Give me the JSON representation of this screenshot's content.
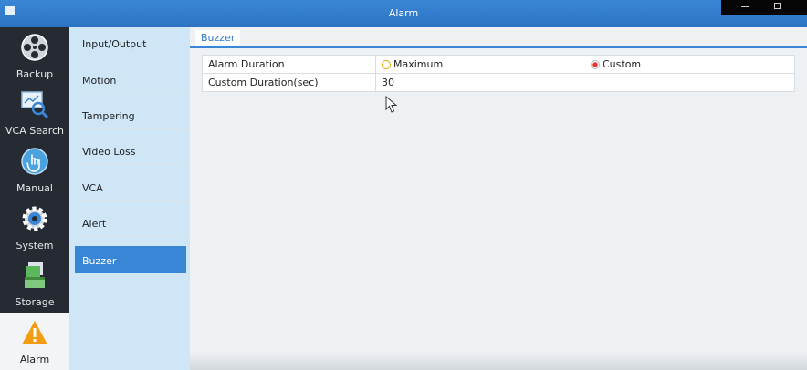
{
  "window": {
    "title": "Alarm",
    "controls": [
      "minimize-icon",
      "maximize-icon"
    ]
  },
  "left_nav": [
    {
      "label": "Backup",
      "icon": "backup-reel-icon"
    },
    {
      "label": "VCA Search",
      "icon": "vca-search-icon"
    },
    {
      "label": "Manual",
      "icon": "manual-hand-icon"
    },
    {
      "label": "System",
      "icon": "system-gear-icon"
    },
    {
      "label": "Storage",
      "icon": "storage-icon"
    },
    {
      "label": "Alarm",
      "icon": "alarm-warning-icon",
      "active": true
    }
  ],
  "sub_menu": [
    {
      "label": "Input/Output"
    },
    {
      "label": "Motion"
    },
    {
      "label": "Tampering"
    },
    {
      "label": "Video Loss"
    },
    {
      "label": "VCA"
    },
    {
      "label": "Alert"
    },
    {
      "label": "Buzzer",
      "active": true
    }
  ],
  "tab": {
    "label": "Buzzer"
  },
  "form": {
    "alarm_duration": {
      "label": "Alarm Duration",
      "options": [
        {
          "label": "Maximum",
          "selected": false
        },
        {
          "label": "Custom",
          "selected": true
        }
      ]
    },
    "custom_duration": {
      "label": "Custom Duration(sec)",
      "value": "30"
    }
  },
  "colors": {
    "accent": "#3a86d6",
    "nav_bg": "#262a32",
    "submenu_bg": "#cfe6f7",
    "radio_selected": "#e53935",
    "radio_unselected": "#e4a500"
  }
}
